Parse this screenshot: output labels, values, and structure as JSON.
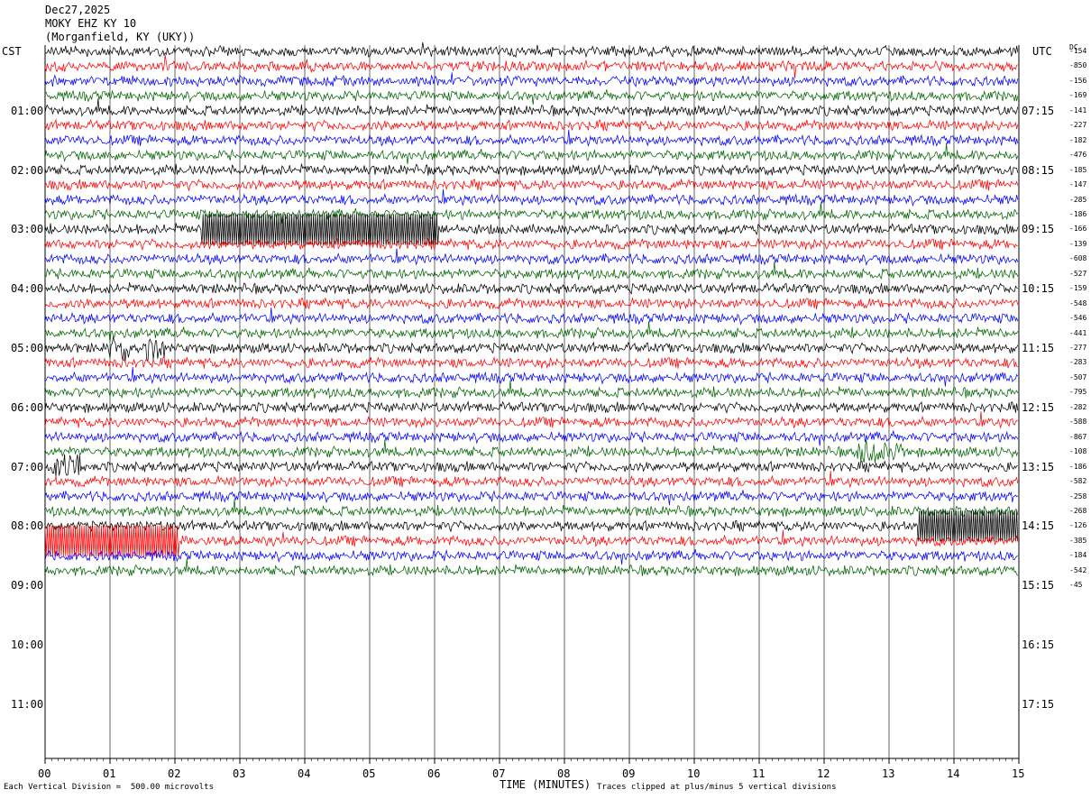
{
  "header": {
    "date": "Dec27,2025",
    "station": "MOKY EHZ KY 10",
    "location": "(Morganfield, KY (UKY))"
  },
  "left_timezone": "CST",
  "right_timezone": "UTC",
  "dc_label": "DC",
  "left_hour_labels": [
    "01:00",
    "02:00",
    "03:00",
    "04:00",
    "05:00",
    "06:00",
    "07:00",
    "08:00",
    "09:00",
    "10:00",
    "11:00"
  ],
  "right_hour_labels": [
    "07:15",
    "08:15",
    "09:15",
    "10:15",
    "11:15",
    "12:15",
    "13:15",
    "14:15",
    "15:15",
    "16:15",
    "17:15"
  ],
  "dc_offsets": [
    "-154",
    "-850",
    "-156",
    "-169",
    "-141",
    "-227",
    "-182",
    "-476",
    "-185",
    "-147",
    "-285",
    "-186",
    "-166",
    "-139",
    "-608",
    "-527",
    "-159",
    "-548",
    "-546",
    "-441",
    "-277",
    "-283",
    "-507",
    "-795",
    "-282",
    "-588",
    "-867",
    "-108",
    "-186",
    "-582",
    "-258",
    "-268",
    "-126",
    "-385",
    "-184",
    "-542",
    "-45"
  ],
  "footer": {
    "vertical_division": "Each Vertical Division =  500.00 microvolts",
    "time_label": "TIME (MINUTES)",
    "clip_note": "Traces clipped at plus/minus 5 vertical divisions"
  },
  "colors": {
    "trace_cycle": [
      "#000000",
      "#ff0000",
      "#0000ff",
      "#006400"
    ],
    "grid": "#000000"
  },
  "chart_data": {
    "type": "line",
    "title": "",
    "xlabel": "TIME (MINUTES)",
    "xlim": [
      0,
      15
    ],
    "x_tick_labels": [
      "00",
      "01",
      "02",
      "03",
      "04",
      "05",
      "06",
      "07",
      "08",
      "09",
      "10",
      "11",
      "12",
      "13",
      "14",
      "15"
    ],
    "rows_per_hour": 4,
    "minutes_per_row": 15,
    "trace_count": 36,
    "events": [
      {
        "trace": 12,
        "start_min": 2.4,
        "end_min": 6.05,
        "kind": "clipped",
        "color": "#ff0000"
      },
      {
        "trace": 20,
        "start_min": 1.0,
        "end_min": 1.3,
        "kind": "burst",
        "color": "#000000"
      },
      {
        "trace": 20,
        "start_min": 1.55,
        "end_min": 1.85,
        "kind": "burst",
        "color": "#000000"
      },
      {
        "trace": 27,
        "start_min": 12.5,
        "end_min": 13.2,
        "kind": "burst",
        "color": "#006400"
      },
      {
        "trace": 28,
        "start_min": 0.1,
        "end_min": 0.55,
        "kind": "burst",
        "color": "#000000"
      },
      {
        "trace": 32,
        "start_min": 13.45,
        "end_min": 15.0,
        "kind": "clipped",
        "color": "#000000"
      },
      {
        "trace": 33,
        "start_min": 0.0,
        "end_min": 2.05,
        "kind": "clipped",
        "color": "#ff0000"
      }
    ]
  }
}
